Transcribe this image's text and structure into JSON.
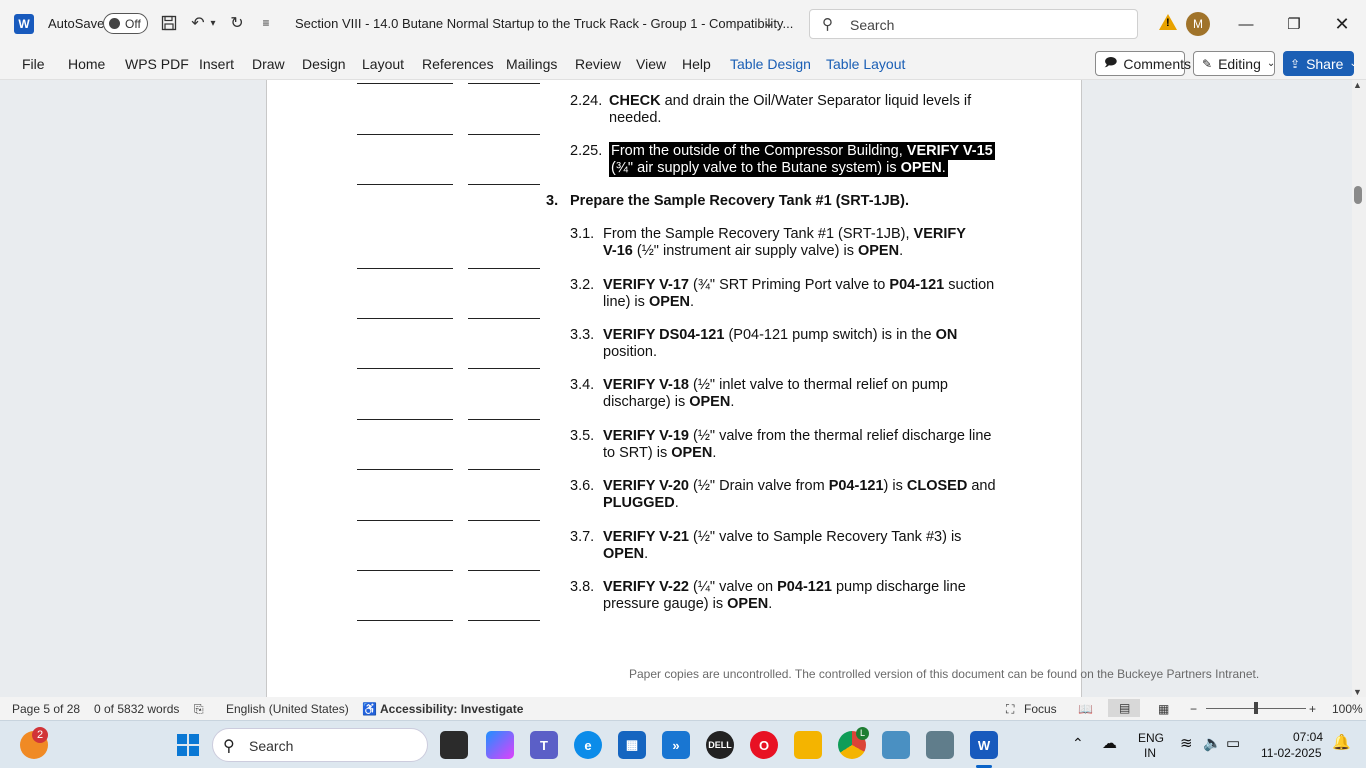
{
  "titlebar": {
    "app_logo_letter": "W",
    "autosave_label": "AutoSave",
    "autosave_state": "Off",
    "document_title": "Section VIII - 14.0 Butane Normal Startup to the Truck Rack - Group 1  -  Compatibility...",
    "search_placeholder": "Search",
    "avatar_initial": "M"
  },
  "ribbon": {
    "tabs": [
      "File",
      "Home",
      "WPS PDF",
      "Insert",
      "Draw",
      "Design",
      "Layout",
      "References",
      "Mailings",
      "Review",
      "View",
      "Help"
    ],
    "context_tabs": [
      "Table Design",
      "Table Layout"
    ],
    "comments_label": "Comments",
    "editing_label": "Editing",
    "share_label": "Share"
  },
  "document": {
    "steps": [
      {
        "num": "2.24.",
        "line1": [
          [
            "b",
            "CHECK"
          ],
          [
            "n",
            " and drain the Oil/Water Separator liquid levels if"
          ]
        ],
        "line2": [
          [
            "n",
            "needed."
          ]
        ]
      },
      {
        "num": "2.25.",
        "highlight": true,
        "line1": [
          [
            "n",
            "From the outside of the Compressor Building, "
          ],
          [
            "b",
            "VERIFY V-15"
          ]
        ],
        "line2": [
          [
            "n",
            "(¾\" air supply valve to the Butane system) is "
          ],
          [
            "b",
            "OPEN"
          ],
          [
            "n",
            "."
          ]
        ]
      },
      {
        "num": "3.",
        "heading": true,
        "line1": [
          [
            "b",
            "Prepare the Sample Recovery Tank #1 (SRT-1JB)."
          ]
        ]
      },
      {
        "num": "3.1.",
        "line1": [
          [
            "n",
            "From the Sample Recovery Tank #1 (SRT-1JB), "
          ],
          [
            "b",
            "VERIFY"
          ]
        ],
        "line2": [
          [
            "b",
            "V-16"
          ],
          [
            "n",
            " (½\" instrument air supply valve) is "
          ],
          [
            "b",
            "OPEN"
          ],
          [
            "n",
            "."
          ]
        ]
      },
      {
        "num": "3.2.",
        "line1": [
          [
            "b",
            "VERIFY V-17"
          ],
          [
            "n",
            " (¾\" SRT Priming Port valve to "
          ],
          [
            "b",
            "P04-121"
          ],
          [
            "n",
            " suction"
          ]
        ],
        "line2": [
          [
            "n",
            "line) is "
          ],
          [
            "b",
            "OPEN"
          ],
          [
            "n",
            "."
          ]
        ]
      },
      {
        "num": "3.3.",
        "line1": [
          [
            "b",
            "VERIFY DS04-121"
          ],
          [
            "n",
            " (P04-121 pump switch) is in the "
          ],
          [
            "b",
            "ON"
          ]
        ],
        "line2": [
          [
            "n",
            "position."
          ]
        ]
      },
      {
        "num": "3.4.",
        "line1": [
          [
            "b",
            "VERIFY V-18"
          ],
          [
            "n",
            " (½\" inlet valve to thermal relief on pump"
          ]
        ],
        "line2": [
          [
            "n",
            "discharge) is "
          ],
          [
            "b",
            "OPEN"
          ],
          [
            "n",
            "."
          ]
        ]
      },
      {
        "num": "3.5.",
        "line1": [
          [
            "b",
            "VERIFY V-19"
          ],
          [
            "n",
            " (½\" valve from the thermal relief discharge line"
          ]
        ],
        "line2": [
          [
            "n",
            "to SRT) is "
          ],
          [
            "b",
            "OPEN"
          ],
          [
            "n",
            "."
          ]
        ]
      },
      {
        "num": "3.6.",
        "line1": [
          [
            "b",
            "VERIFY V-20"
          ],
          [
            "n",
            " (½\" Drain valve from "
          ],
          [
            "b",
            "P04-121"
          ],
          [
            "n",
            ") is "
          ],
          [
            "b",
            "CLOSED"
          ],
          [
            "n",
            " and"
          ]
        ],
        "line2": [
          [
            "b",
            "PLUGGED"
          ],
          [
            "n",
            "."
          ]
        ]
      },
      {
        "num": "3.7.",
        "line1": [
          [
            "b",
            "VERIFY V-21"
          ],
          [
            "n",
            " (½\" valve to Sample Recovery Tank #3) is"
          ]
        ],
        "line2": [
          [
            "b",
            "OPEN"
          ],
          [
            "n",
            "."
          ]
        ]
      },
      {
        "num": "3.8.",
        "line1": [
          [
            "b",
            "VERIFY V-22"
          ],
          [
            "n",
            " (¼\" valve on "
          ],
          [
            "b",
            "P04-121"
          ],
          [
            "n",
            " pump discharge line"
          ]
        ],
        "line2": [
          [
            "n",
            "pressure gauge) is "
          ],
          [
            "b",
            "OPEN"
          ],
          [
            "n",
            "."
          ]
        ]
      }
    ],
    "footer_note": "Paper copies are uncontrolled. The controlled version of this document can be found on the Buckeye Partners Intranet."
  },
  "statusbar": {
    "page_info": "Page 5 of 28",
    "word_count": "0 of 5832 words",
    "language": "English (United States)",
    "accessibility": "Accessibility: Investigate",
    "focus_label": "Focus",
    "zoom_level": "100%",
    "zoom_fraction": 0.5
  },
  "taskbar": {
    "notification_badge": "2",
    "search_placeholder": "Search",
    "chrome_badge": "L",
    "language_line1": "ENG",
    "language_line2": "IN",
    "time": "07:04",
    "date": "11-02-2025"
  },
  "colors": {
    "word_blue": "#185abd",
    "context_tab_blue": "#1b5fb5",
    "highlight_bg": "#000000"
  }
}
